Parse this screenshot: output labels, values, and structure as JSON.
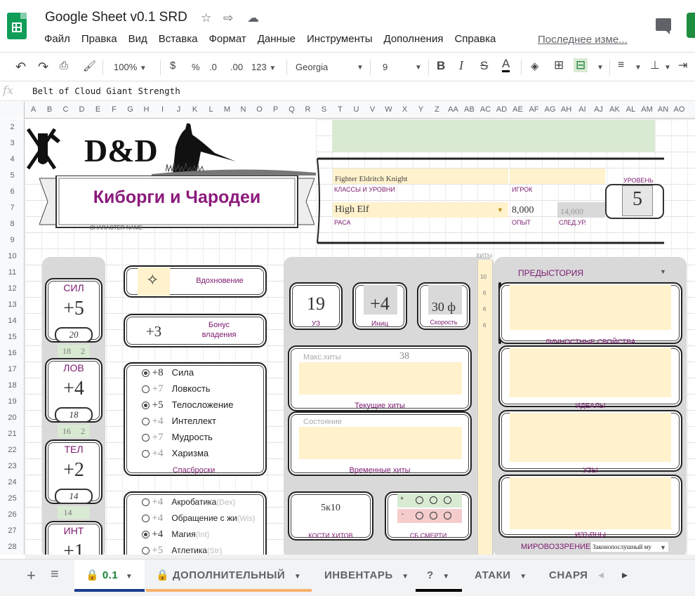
{
  "app": {
    "doc_title": "Google Sheet v0.1 SRD",
    "menu": [
      "Файл",
      "Правка",
      "Вид",
      "Вставка",
      "Формат",
      "Данные",
      "Инструменты",
      "Дополнения",
      "Справка"
    ],
    "last_edit": "Последнее изме..."
  },
  "toolbar": {
    "zoom": "100%",
    "currency": "$",
    "percent": "%",
    "dec_less": ".0",
    "dec_more": ".00",
    "format_more": "123",
    "font": "Georgia",
    "font_size": "9",
    "bold": "B",
    "italic": "I",
    "strike": "S",
    "text_color": "A"
  },
  "formula": {
    "fx": "fx",
    "value": "Belt of Cloud Giant Strength"
  },
  "columns": [
    "A",
    "B",
    "C",
    "D",
    "E",
    "F",
    "G",
    "H",
    "I",
    "J",
    "K",
    "L",
    "M",
    "N",
    "O",
    "P",
    "Q",
    "R",
    "S",
    "T",
    "U",
    "V",
    "W",
    "X",
    "Y",
    "Z",
    "AA",
    "AB",
    "AC",
    "AD",
    "AE",
    "AF",
    "AG",
    "AH",
    "AI",
    "AJ",
    "AK",
    "AL",
    "AM",
    "AN",
    "AO"
  ],
  "rows": [
    "2",
    "3",
    "4",
    "5",
    "6",
    "7",
    "8",
    "9",
    "10",
    "11",
    "12",
    "13",
    "14",
    "15",
    "16",
    "17",
    "18",
    "19",
    "20",
    "21",
    "22",
    "23",
    "24",
    "25",
    "26",
    "27",
    "28"
  ],
  "header": {
    "character_name": "Киборги и Чародеи",
    "character_name_label": "CHARACTER NAME",
    "class_value": "Fighter Eldritch Knight",
    "class_label": "КЛАССЫ И УРОВНИ",
    "player_label": "ИГРОК",
    "level_label": "УРОВЕНЬ",
    "level": "5",
    "race_value": "High Elf",
    "race_label": "РАСА",
    "xp_value": "8,000",
    "xp_label": "ОПЫТ",
    "next_xp_value": "14,000",
    "next_xp_label": "СЛЕД.УР."
  },
  "abilities": [
    {
      "name": "СИЛ",
      "mod": "+5",
      "score": "20",
      "extra": [
        "18",
        "2"
      ]
    },
    {
      "name": "ЛОВ",
      "mod": "+4",
      "score": "18",
      "extra": [
        "16",
        "2"
      ]
    },
    {
      "name": "ТЕЛ",
      "mod": "+2",
      "score": "14",
      "extra": [
        "14",
        ""
      ]
    },
    {
      "name": "ИНТ",
      "mod": "+1",
      "score": "",
      "extra": [
        "",
        ""
      ]
    }
  ],
  "inspiration_label": "Вдохновение",
  "proficiency": {
    "value": "+3",
    "label": "Бонус владения"
  },
  "saves": {
    "label": "Спасброски",
    "items": [
      {
        "mod": "+8",
        "name": "Сила",
        "on": true
      },
      {
        "mod": "+7",
        "name": "Ловкость",
        "on": false
      },
      {
        "mod": "+5",
        "name": "Телосложение",
        "on": true
      },
      {
        "mod": "+4",
        "name": "Интеллект",
        "on": false
      },
      {
        "mod": "+7",
        "name": "Мудрость",
        "on": false
      },
      {
        "mod": "+4",
        "name": "Харизма",
        "on": false
      }
    ]
  },
  "skills": [
    {
      "mod": "+4",
      "name": "Акробатика",
      "attr": "(Dex)",
      "on": false
    },
    {
      "mod": "+4",
      "name": "Обращение с жи",
      "attr": "(Wis)",
      "on": false
    },
    {
      "mod": "+4",
      "name": "Магия",
      "attr": "(Int)",
      "on": true
    },
    {
      "mod": "+5",
      "name": "Атлетика",
      "attr": "(Str)",
      "on": false
    }
  ],
  "combat": {
    "ac": "19",
    "ac_label": "УЗ",
    "init": "+4",
    "init_label": "Иниц",
    "speed": "30 ф",
    "speed_label": "Скорость",
    "max_hp_label": "Макс.хиты",
    "max_hp": "38",
    "current_hp_label": "Текущие хиты",
    "condition_label": "Состояние",
    "temp_hp_label": "Временные хиты",
    "hit_dice": "5к10",
    "hit_dice_label": "КОСТИ ХИТОВ",
    "death_saves_label": "СБ СМЕРТИ",
    "death_success": "+",
    "death_fail": "-"
  },
  "hp_strip": {
    "label": "ХИТЫ",
    "values": [
      "10",
      "6",
      "6",
      "6"
    ]
  },
  "background": {
    "label": "ПРЕДЫСТОРИЯ",
    "traits_label": "ЛИЧНОСТНЫЕ СВОЙСТВА",
    "ideals_label": "ИДЕАЛЫ",
    "bonds_label": "УЗЫ",
    "flaws_label": "ИЗЪЯНЫ",
    "alignment_label": "МИРОВОЗЗРЕНИЕ",
    "alignment_value": "Законопослушный му"
  },
  "tabs": [
    {
      "label": "0.1",
      "active": true
    },
    {
      "label": "ДОПОЛНИТЕЛЬНЫЙ"
    },
    {
      "label": "ИНВЕНТАРЬ"
    },
    {
      "label": "?"
    },
    {
      "label": "АТАКИ"
    },
    {
      "label": "СНАРЯ"
    }
  ],
  "colors": {
    "accent_purple": "#7b1a6f",
    "cream": "#fff2cc",
    "green_fill": "#d9ead3",
    "panel_gray": "#d9d9d9",
    "sheets_green": "#188038"
  }
}
